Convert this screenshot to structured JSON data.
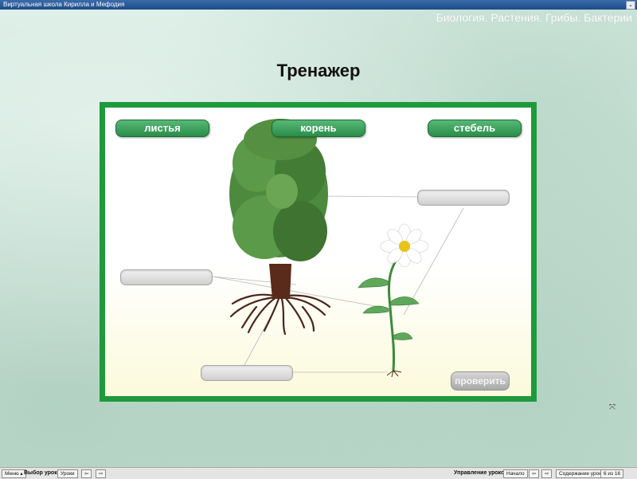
{
  "window": {
    "title": "Виртуальная школа Кирилла и Мефодия",
    "control_glyph": "⌄"
  },
  "subject": "Биология. Растения. Грибы. Бактерии",
  "heading": "Тренажер",
  "exercise": {
    "words": [
      "листья",
      "корень",
      "стебель"
    ],
    "check_label": "проверить"
  },
  "statusbar": {
    "menu_label": "Меню",
    "lesson_select_label": "Выбор урока:",
    "lessons_button": "Уроки",
    "lesson_control_label": "Управление уроком:",
    "start_button": "Начало",
    "contents_button": "Содержание урока",
    "page_counter": "6 из 16"
  },
  "colors": {
    "panel_border": "#1e9a3c",
    "word_button": "#2a8d4a",
    "titlebar": "#1e4c8a"
  },
  "icons": [
    "chevron-down-icon",
    "arrow-left-icon",
    "arrow-right-icon",
    "resize-icon"
  ]
}
